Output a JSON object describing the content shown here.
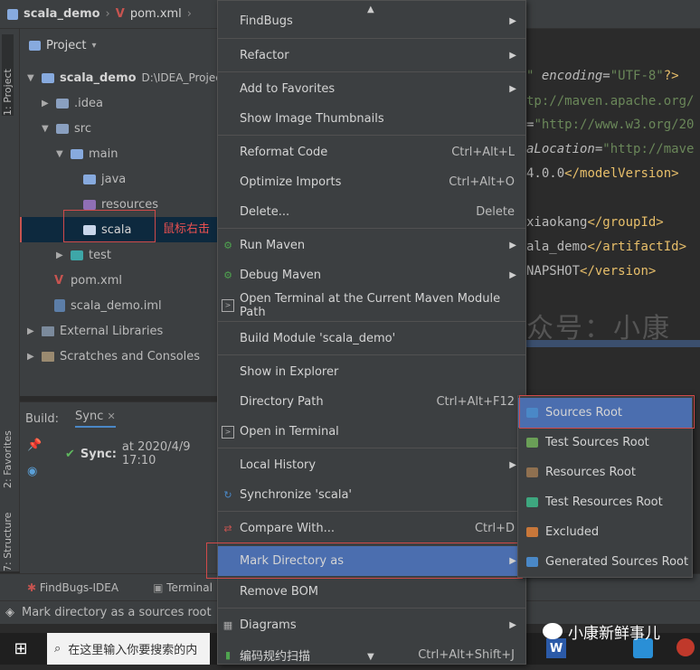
{
  "nav": {
    "project": "scala_demo",
    "file": "pom.xml"
  },
  "sidebar": {
    "tab_project": "1: Project",
    "tab_favorites": "2: Favorites",
    "tab_structure": "7: Structure"
  },
  "project_panel": {
    "title": "Project",
    "tree": [
      {
        "label": "scala_demo",
        "extra": "D:\\IDEA_Projects\\s"
      },
      {
        "label": ".idea"
      },
      {
        "label": "src"
      },
      {
        "label": "main"
      },
      {
        "label": "java"
      },
      {
        "label": "resources"
      },
      {
        "label": "scala"
      },
      {
        "label": "test"
      },
      {
        "label": "pom.xml"
      },
      {
        "label": "scala_demo.iml"
      },
      {
        "label": "External Libraries"
      },
      {
        "label": "Scratches and Consoles"
      }
    ],
    "annotation": "鼠标右击"
  },
  "build": {
    "label": "Build:",
    "tab": "Sync",
    "sync_title": "Sync:",
    "sync_time": "at 2020/4/9 17:10"
  },
  "editor": {
    "lines": [
      {
        "a": "\"",
        "b": " encoding",
        "c": "=",
        "d": "\"UTF-8\"",
        "e": "?>"
      },
      {
        "a": "tp://maven.apache.org/"
      },
      {
        "a": "=",
        "d": "\"http://www.w3.org/20"
      },
      {
        "a": "aLocation",
        "c": "=",
        "d": "\"http://mave"
      },
      {
        "a": "4.0.0",
        "e": "</modelVersion>"
      },
      {
        "a": ""
      },
      {
        "a": "xiaokang",
        "e": "</groupId>"
      },
      {
        "a": "ala_demo",
        "e": "</artifactId>"
      },
      {
        "a": "NAPSHOT",
        "e": "</version>"
      }
    ],
    "watermark": "众号：小康"
  },
  "context_menu": [
    {
      "label": "FindBugs",
      "sub": true
    },
    {
      "label": "Refactor",
      "sub": true
    },
    {
      "label": "Add to Favorites",
      "sub": true
    },
    {
      "label": "Show Image Thumbnails"
    },
    {
      "label": "Reformat Code",
      "shortcut": "Ctrl+Alt+L"
    },
    {
      "label": "Optimize Imports",
      "shortcut": "Ctrl+Alt+O"
    },
    {
      "label": "Delete...",
      "shortcut": "Delete"
    },
    {
      "label": "Run Maven",
      "sub": true
    },
    {
      "label": "Debug Maven",
      "sub": true
    },
    {
      "label": "Open Terminal at the Current Maven Module Path"
    },
    {
      "label": "Build Module 'scala_demo'"
    },
    {
      "label": "Show in Explorer"
    },
    {
      "label": "Directory Path",
      "shortcut": "Ctrl+Alt+F12"
    },
    {
      "label": "Open in Terminal"
    },
    {
      "label": "Local History",
      "sub": true
    },
    {
      "label": "Synchronize 'scala'"
    },
    {
      "label": "Compare With...",
      "shortcut": "Ctrl+D"
    },
    {
      "label": "Mark Directory as",
      "sub": true
    },
    {
      "label": "Remove BOM"
    },
    {
      "label": "Diagrams",
      "sub": true
    },
    {
      "label": "编码规约扫描",
      "shortcut": "Ctrl+Alt+Shift+J"
    }
  ],
  "submenu": [
    {
      "label": "Sources Root",
      "color": "#4a88c7"
    },
    {
      "label": "Test Sources Root",
      "color": "#6a9f57"
    },
    {
      "label": "Resources Root",
      "color": "#8f7050"
    },
    {
      "label": "Test Resources Root",
      "color": "#3ea77f"
    },
    {
      "label": "Excluded",
      "color": "#c8773a"
    },
    {
      "label": "Generated Sources Root",
      "color": "#4a88c7"
    }
  ],
  "toolwindows": {
    "findbugs": "FindBugs-IDEA",
    "terminal": "Terminal"
  },
  "status": {
    "text": "Mark directory as a sources root"
  },
  "taskbar": {
    "search_placeholder": "在这里输入你要搜索的内"
  },
  "wechat": {
    "name": "小康新鲜事儿"
  }
}
